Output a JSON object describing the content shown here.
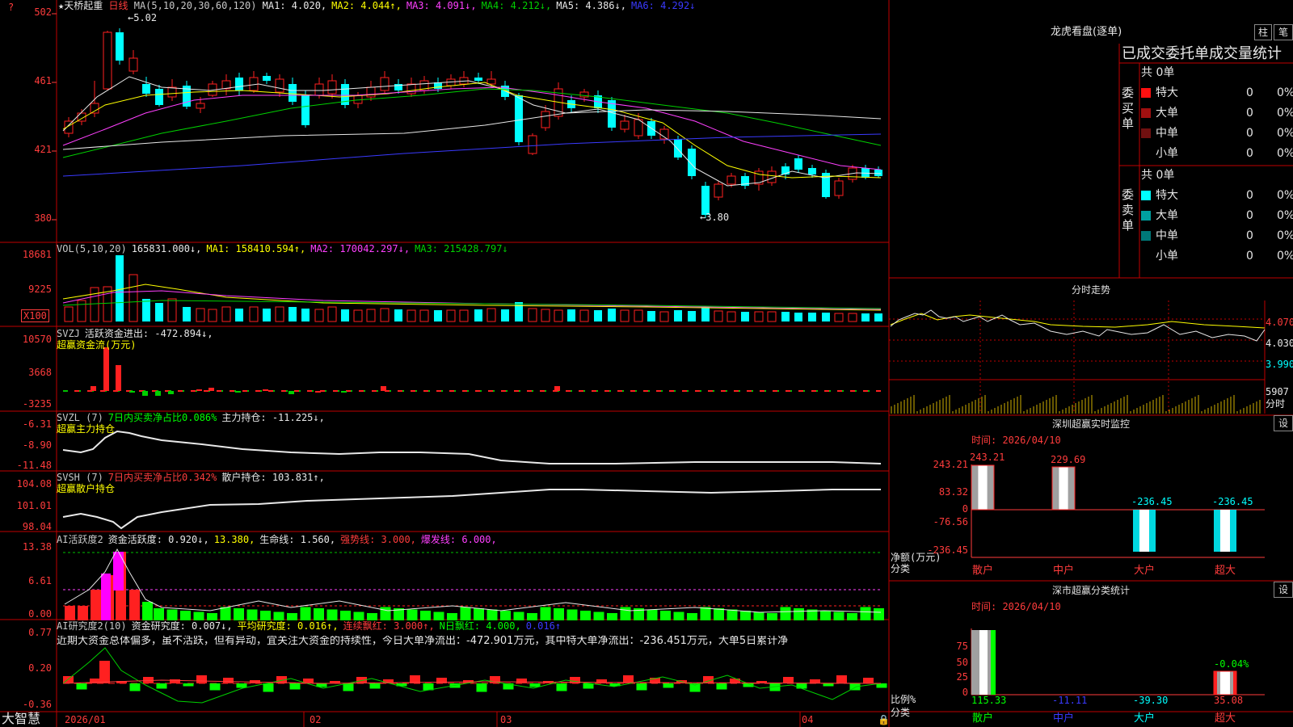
{
  "app": {
    "logo": "大智慧",
    "stock_title": "★天桥起重",
    "period": "日线"
  },
  "main_panel": {
    "ma_prefix": "MA(5,10,20,30,60,120)",
    "ma": [
      {
        "label": "MA1: 4.020,",
        "color": "#e8e8e8"
      },
      {
        "label": "MA2: 4.044↑,",
        "color": "#ffff00"
      },
      {
        "label": "MA3: 4.091↓,",
        "color": "#ff40ff"
      },
      {
        "label": "MA4: 4.212↓,",
        "color": "#00d000"
      },
      {
        "label": "MA5: 4.386↓,",
        "color": "#e8e8e8"
      },
      {
        "label": "MA6: 4.292↓",
        "color": "#3a3aff"
      }
    ],
    "y_labels": [
      "502",
      "461",
      "421",
      "380"
    ],
    "high_mark": "5.02",
    "low_mark": "3.80",
    "question_mark": "?"
  },
  "vol_panel": {
    "labels": [
      {
        "t": "VOL(5,10,20)",
        "c": "#c8c8c8"
      },
      {
        "t": "165831.000↓,",
        "c": "#e8e8e8"
      },
      {
        "t": "MA1: 158410.594↑,",
        "c": "#ffff00"
      },
      {
        "t": "MA2: 170042.297↓,",
        "c": "#ff40ff"
      },
      {
        "t": "MA3: 215428.797↓",
        "c": "#00d000"
      }
    ],
    "y_labels": [
      "18681",
      "9225"
    ],
    "unit": "X100"
  },
  "svzj_panel": {
    "labels": [
      {
        "t": "SVZJ",
        "c": "#c8c8c8"
      },
      {
        "t": "活跃资金进出: -472.894↓,",
        "c": "#e8e8e8"
      }
    ],
    "sub": "超赢资金流(万元)",
    "y_labels": [
      "10570",
      "3668",
      "-3235"
    ]
  },
  "svzl_panel": {
    "labels": [
      {
        "t": "SVZL (7)",
        "c": "#c8c8c8"
      },
      {
        "t": "7日内买卖净占比0.086%",
        "c": "#00ff00"
      },
      {
        "t": "主力持仓: -11.225↓,",
        "c": "#e8e8e8"
      }
    ],
    "sub": "超赢主力持仓",
    "y_labels": [
      "-6.31",
      "-8.90",
      "-11.48"
    ]
  },
  "svsh_panel": {
    "labels": [
      {
        "t": "SVSH (7)",
        "c": "#c8c8c8"
      },
      {
        "t": "7日内买卖净占比0.342%",
        "c": "#ff3c3c"
      },
      {
        "t": "散户持仓: 103.831↑,",
        "c": "#e8e8e8"
      }
    ],
    "sub": "超赢散户持仓",
    "y_labels": [
      "104.08",
      "101.01",
      "98.04"
    ]
  },
  "ai_active_panel": {
    "labels": [
      {
        "t": "AI活跃度2",
        "c": "#c8c8c8"
      },
      {
        "t": "资金活跃度: 0.920↓,",
        "c": "#e8e8e8"
      },
      {
        "t": "13.380,",
        "c": "#ffff00"
      },
      {
        "t": "生命线: 1.560,",
        "c": "#e8e8e8"
      },
      {
        "t": "强势线: 3.000,",
        "c": "#ff3c3c"
      },
      {
        "t": "爆发线: 6.000,",
        "c": "#ff40ff"
      }
    ],
    "y_labels": [
      "13.38",
      "6.61",
      "0.00"
    ]
  },
  "ai_research_panel": {
    "labels": [
      {
        "t": "AI研究度2(10)",
        "c": "#c8c8c8"
      },
      {
        "t": "资金研究度: 0.007↓,",
        "c": "#e8e8e8"
      },
      {
        "t": "平均研究度: 0.016↑,",
        "c": "#ffff00"
      },
      {
        "t": "连续飘红: 3.000↑,",
        "c": "#ff3c3c"
      },
      {
        "t": "N日飘红: 4.000,",
        "c": "#00ff00"
      },
      {
        "t": "0.016↑",
        "c": "#3a3aff"
      }
    ],
    "comment": "近期大资金总体偏多，虽不活跃，但有异动，宜关注大资金的持续性，今日大单净流出：-472.901万元，其中特大单净流出：-236.451万元，大单5日累计净",
    "y_labels": [
      "0.77",
      "0.20",
      "-0.36"
    ]
  },
  "time_axis": [
    "2026/01",
    "02",
    "03",
    "04"
  ],
  "right": {
    "lhkp_title": "龙虎看盘(逐单)",
    "btn_bar": "柱",
    "btn_pen": "笔",
    "stats_title": "已成交委托单成交量统计",
    "buy": {
      "side": "委买单",
      "total": "共 0单",
      "rows": [
        {
          "name": "特大",
          "v": "0",
          "p": "0%",
          "color": "#ff1010"
        },
        {
          "name": "大单",
          "v": "0",
          "p": "0%",
          "color": "#a01010"
        },
        {
          "name": "中单",
          "v": "0",
          "p": "0%",
          "color": "#701010"
        },
        {
          "name": "小单",
          "v": "0",
          "p": "0%",
          "color": "#000000"
        }
      ]
    },
    "sell": {
      "side": "委卖单",
      "total": "共 0单",
      "rows": [
        {
          "name": "特大",
          "v": "0",
          "p": "0%",
          "color": "#00ffff"
        },
        {
          "name": "大单",
          "v": "0",
          "p": "0%",
          "color": "#00a0a0"
        },
        {
          "name": "中单",
          "v": "0",
          "p": "0%",
          "color": "#007878"
        },
        {
          "name": "小单",
          "v": "0",
          "p": "0%",
          "color": "#000000"
        }
      ]
    },
    "intraday": {
      "title": "分时走势",
      "p1": "4.070",
      "p2": "4.030",
      "p3": "3.990",
      "vol": "5907",
      "vol_unit": "分时"
    },
    "monitor": {
      "title": "深圳超赢实时监控",
      "settings": "设",
      "time": "时间: 2026/04/10",
      "y_labels": [
        "243.21",
        "83.32",
        "0",
        "-76.56",
        "-236.45"
      ],
      "bar_values": [
        "243.21",
        "229.69",
        "-236.45",
        "-236.45"
      ],
      "cats": [
        "散户",
        "中户",
        "大户",
        "超大"
      ],
      "unit": "净额(万元)",
      "axis_name": "分类"
    },
    "classify": {
      "title": "深市超赢分类统计",
      "settings": "设",
      "time": "时间: 2026/04/10",
      "y_labels": [
        "75",
        "50",
        "25",
        "0"
      ],
      "ratio_values": [
        "115.33",
        "-11.11",
        "-39.30",
        "35.08"
      ],
      "top_note": "-0.04%",
      "cats": [
        "散户",
        "中户",
        "大户",
        "超大"
      ],
      "unit": "比例%",
      "axis_name": "分类"
    }
  }
}
